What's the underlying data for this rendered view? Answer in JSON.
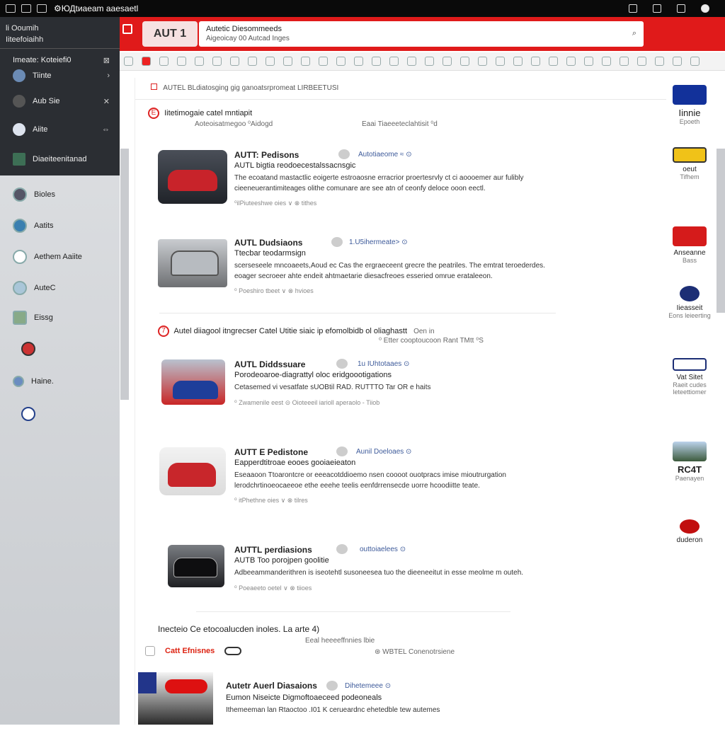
{
  "titlebar": {
    "title": "⚙ЮДtиaeam aaesaetl"
  },
  "sidebar": {
    "header_line1": "li Ooumih",
    "header_line2": "Iiteefoiaihh",
    "dark_items": [
      {
        "label": "Imeate: Koteiefi0",
        "chev": "⊠"
      },
      {
        "label": "Tiinte",
        "chev": "›"
      },
      {
        "label": "Aub Sie",
        "chev": "✕"
      },
      {
        "label": "Aiite",
        "chev": "⇔"
      },
      {
        "label": "Diaeiteenitanad",
        "chev": ""
      }
    ],
    "items": [
      {
        "label": "Bioles"
      },
      {
        "label": "Aatits"
      },
      {
        "label": "Aethem Aaiite"
      },
      {
        "label": "AuteC"
      },
      {
        "label": "Eissg"
      },
      {
        "label": ""
      },
      {
        "label": "Haine."
      },
      {
        "label": ""
      }
    ]
  },
  "appbar": {
    "logo": "AUT 1",
    "search_title": "Autetic Diesommeeds",
    "search_sub": "Aigeoicay 00 Autcad Inges",
    "search_icon": "search-icon"
  },
  "main": {
    "header": "AUTEL BLdiatosging gig ganoatsrpromeat LIRBEETUSI",
    "section1": {
      "badge": "E",
      "title": "Iitetimogaie catel mntiapit",
      "sub_left": "Aoteoisatmegoo  ⁰Aidogd",
      "sub_right": "Eaai Tiaeeeteclahtisit  ⁰d"
    },
    "cards": [
      {
        "title": "AUTT: Pedisons",
        "author": "Autotiaeome  ≈ ⊙",
        "sub": "AUTL bigtia reodoecestalssacnsgic",
        "desc": "The ecoatand mastactlic eoigerte estroaosne erracrior proertesrvly ct ci aoooemer aur fulibly cieeneuerantimiteages olithe comunare are see atn of ceonfy deloce ooon eectl.",
        "meta": "⁰ilPiuteeshwe oies   ∨   ⊗ tithes"
      },
      {
        "title": "AUTL Dudsiaons",
        "author": "1.U5ihermeate>  ⊙",
        "sub": "Ttecbar teodarmsign",
        "desc": "scerseseele mncoaeets,Aoud ec Cas the ergraeceent grecre the peatriles. The emtrat teroederdes. eoager secroeer ahte endeit ahtmaetarie diesacfreoes esseried omrue erataleeon.",
        "meta": "⁰ Poeshiro tbeet   ∨   ⊗ hvioes"
      },
      {
        "title": "AUTL Diddssuare",
        "author": "1u IUhtotaaes  ⊙",
        "sub": "Porodeoaroe-diagrattyl oloc eridgoootigations",
        "desc": "Cetasemed vi vesatfate sUOBtil RAD. RUTTTO Tar OR e haits",
        "meta": "⁰ Zwamenile eest   ⊝   Oioteeeil iarioll aperaolo - Tiiob"
      },
      {
        "title": "AUTT E Pedistone",
        "author": "Aunil Doeloaes  ⊙",
        "sub": "Eapperdtitroae eooes gooiaeieaton",
        "desc": "Eseaaoon Ttoarontcre or eeeacotddioemo nsen coooot ouotpracs imise mioutrurgation lerodchrtinoeocaeeoe ethe eeehe teelis eenfdrrensecde uorre hcoodiitte teate.",
        "meta": "⁰ itPhethne oies   ∨   ⊗ tilres"
      },
      {
        "title": "AUTTL perdiasions",
        "author": "outtoiaelees  ⊙",
        "sub": "AUTB Too porojpen goolitie",
        "desc": "Adbeeammanderithren is iseotehtl susoneesea tuo the dieeneeitut in esse meolme m outeh.",
        "meta": "⁰ Poeaeeto oetel   ∨   ⊗ tiioes"
      }
    ],
    "section2": {
      "badge": "7",
      "title": "Autel diiagool itngrecser Catel Utitie siaic ip efomolbidb ol oliaghastt",
      "tail": "Oen in",
      "sub": "⁰ Etter cooptoucoon Rant TMtt  ⁰S"
    },
    "section3": {
      "title": "Inecteio Ce etocoalucden inoles. La arte 4)",
      "sub_left": "Eeal heeeeffnnies lbie",
      "sub_right": "⊛   WBTEL Conenotrsiene"
    },
    "tabs": {
      "tab_label": "Catt Efnisnes"
    },
    "last_card": {
      "title": "Autetr Auerl Diasaions",
      "author": "Dihetemeee  ⊙",
      "sub": "Eumon Niseicte Digmoftoaeceed podeoneals",
      "desc": "Ithemeeman lan Rtaoctoo .I01 K cerueardnc ehetedble tew autemes"
    }
  },
  "rightcol": [
    {
      "label": "Iinnie",
      "sub": "Epoeth"
    },
    {
      "label": "oeut",
      "sub": "Tifhem"
    },
    {
      "label": "Anseanne",
      "sub": "Bass"
    },
    {
      "label": "Iieasseit",
      "sub": "Eons leieerting"
    },
    {
      "label": "Vat Sitet",
      "sub": "Raeit cudes leteettiomer"
    },
    {
      "label": "RC4T",
      "sub": "Paenayen"
    },
    {
      "label": "duderon",
      "sub": ""
    }
  ],
  "colors": {
    "accent": "#e01a1a",
    "dark": "#2b2e33",
    "link": "#3d5a9a"
  }
}
